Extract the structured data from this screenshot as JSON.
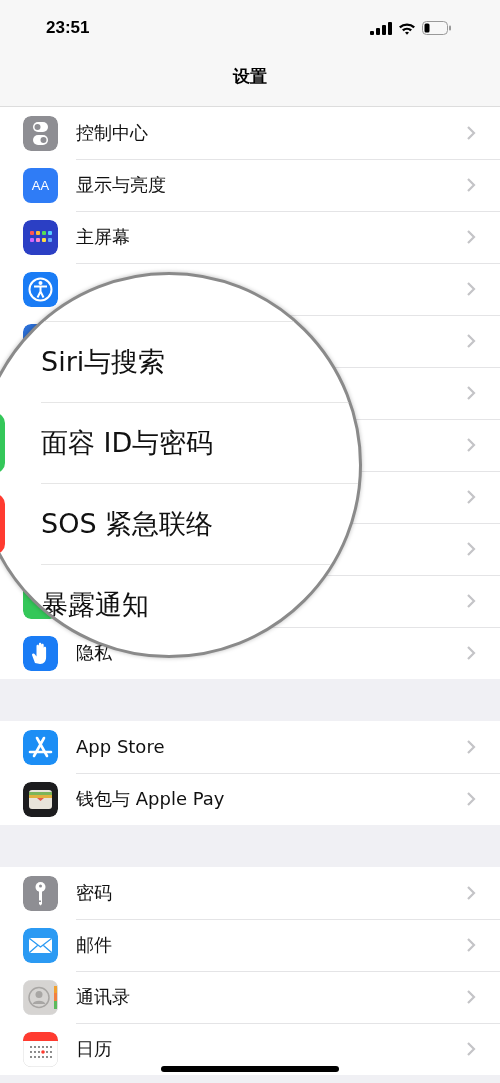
{
  "status_bar": {
    "time": "23:51"
  },
  "nav": {
    "title": "设置"
  },
  "groups": [
    {
      "rows": [
        {
          "label": "控制中心",
          "kind": "toggles",
          "color": "#8e8e93"
        },
        {
          "label": "显示与亮度",
          "kind": "text",
          "icon_text": "AA",
          "color": "#2f7cf6"
        },
        {
          "label": "主屏幕",
          "kind": "grid",
          "color": "#2b3fc4"
        },
        {
          "kind": "accessibility",
          "color": "#1a7cf5"
        },
        {
          "kind": "plain",
          "color": "#2c6fd6"
        },
        {},
        {},
        {},
        {},
        {
          "kind": "plain",
          "color": "#34c759"
        },
        {
          "label": "隐私",
          "kind": "hand",
          "color": "#1a7cf5"
        }
      ]
    },
    {
      "rows": [
        {
          "label": "App Store",
          "kind": "appstore",
          "color": "#1c8ef5"
        },
        {
          "label": "钱包与 Apple Pay",
          "kind": "wallet",
          "color": "#1c1c1e"
        }
      ]
    },
    {
      "rows": [
        {
          "label": "密码",
          "kind": "key",
          "color": "#8e8e93"
        },
        {
          "label": "邮件",
          "kind": "mail",
          "color": "#2b9af3"
        },
        {
          "label": "通讯录",
          "kind": "contacts",
          "color": "#d6d4d2"
        },
        {
          "label": "日历",
          "kind": "calendar"
        }
      ]
    }
  ],
  "magnifier": {
    "rows": [
      {
        "label": "Siri与搜索"
      },
      {
        "label": "面容 ID与密码",
        "color": "#34c759"
      },
      {
        "label": "SOS 紧急联络",
        "color": "#ff3b30"
      },
      {
        "label": "暴露通知"
      }
    ]
  }
}
